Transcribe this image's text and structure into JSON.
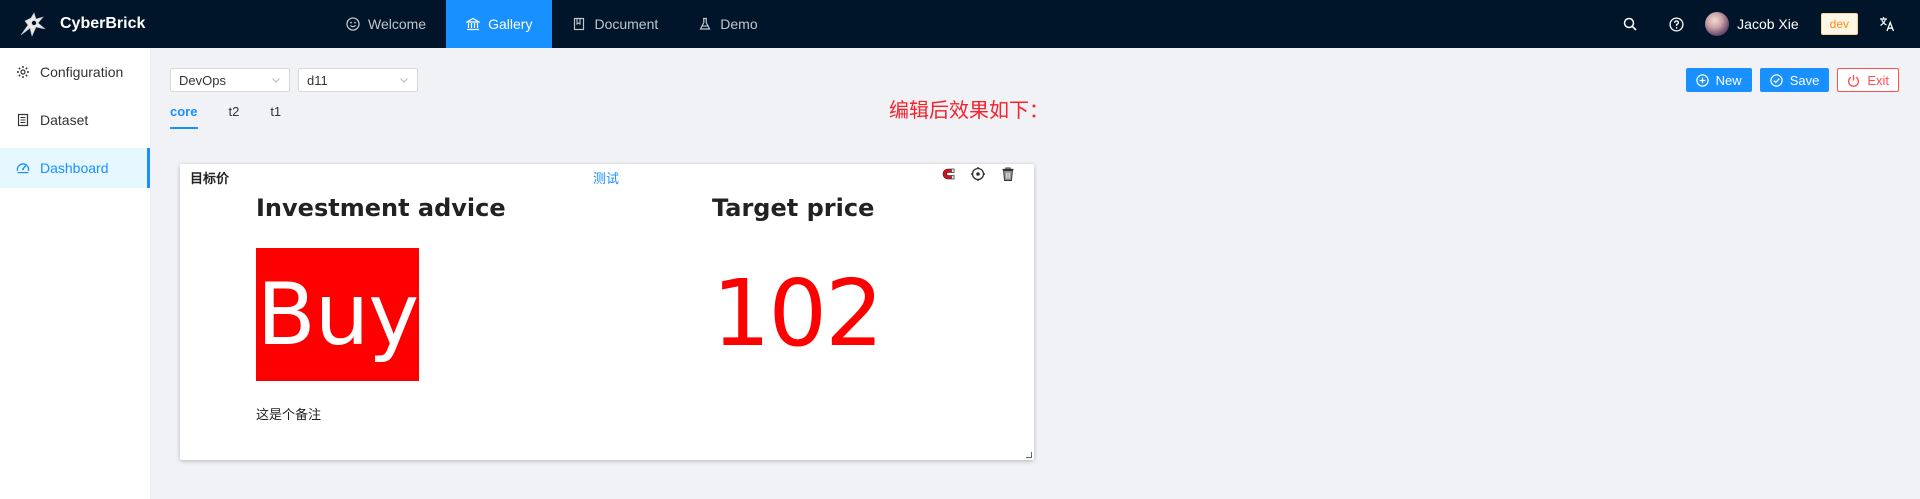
{
  "brand": {
    "name": "CyberBrick"
  },
  "nav": [
    {
      "label": "Welcome",
      "icon": "smile-icon",
      "active": false
    },
    {
      "label": "Gallery",
      "icon": "bank-icon",
      "active": true
    },
    {
      "label": "Document",
      "icon": "book-icon",
      "active": false
    },
    {
      "label": "Demo",
      "icon": "flask-icon",
      "active": false
    }
  ],
  "header": {
    "user_name": "Jacob Xie",
    "env_tag": "dev"
  },
  "sidebar": {
    "items": [
      {
        "label": "Configuration",
        "icon": "gear-icon",
        "active": false
      },
      {
        "label": "Dataset",
        "icon": "book-icon",
        "active": false
      },
      {
        "label": "Dashboard",
        "icon": "dashboard-icon",
        "active": true
      }
    ]
  },
  "selects": {
    "category": "DevOps",
    "dashboard": "d11"
  },
  "tabs": [
    {
      "label": "core",
      "active": true
    },
    {
      "label": "t2",
      "active": false
    },
    {
      "label": "t1",
      "active": false
    }
  ],
  "note": "编辑后效果如下：",
  "actions": {
    "new_label": "New",
    "save_label": "Save",
    "exit_label": "Exit"
  },
  "card": {
    "title": "目标价",
    "link": "测试",
    "investment": {
      "heading": "Investment advice",
      "value": "Buy",
      "remark": "这是个备注"
    },
    "target": {
      "heading": "Target price",
      "value": "102"
    }
  },
  "colors": {
    "header_bg": "#001529",
    "accent": "#1890ff",
    "highlight_red": "#ff0000",
    "env_tag": "#fa8c16"
  }
}
